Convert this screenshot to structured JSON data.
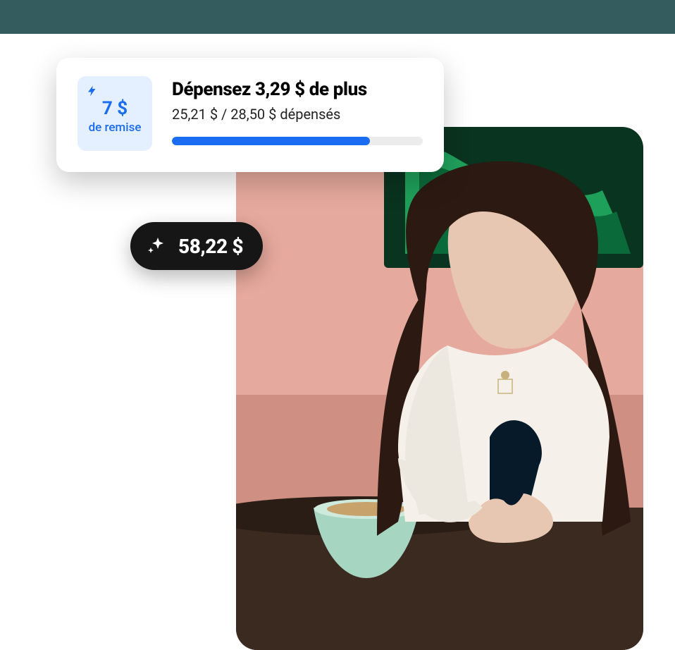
{
  "promo": {
    "badge_amount": "7 $",
    "badge_label": "de remise",
    "title": "Dépensez 3,29 $ de plus",
    "subtitle": "25,21 $ / 28,50 $ dépensés",
    "progress_pct": 79
  },
  "balance": {
    "amount": "58,22 $"
  },
  "colors": {
    "accent_blue": "#1a6cf0",
    "badge_bg": "#e4f0ff",
    "pill_bg": "#161616",
    "header_bg": "#345b5e"
  }
}
